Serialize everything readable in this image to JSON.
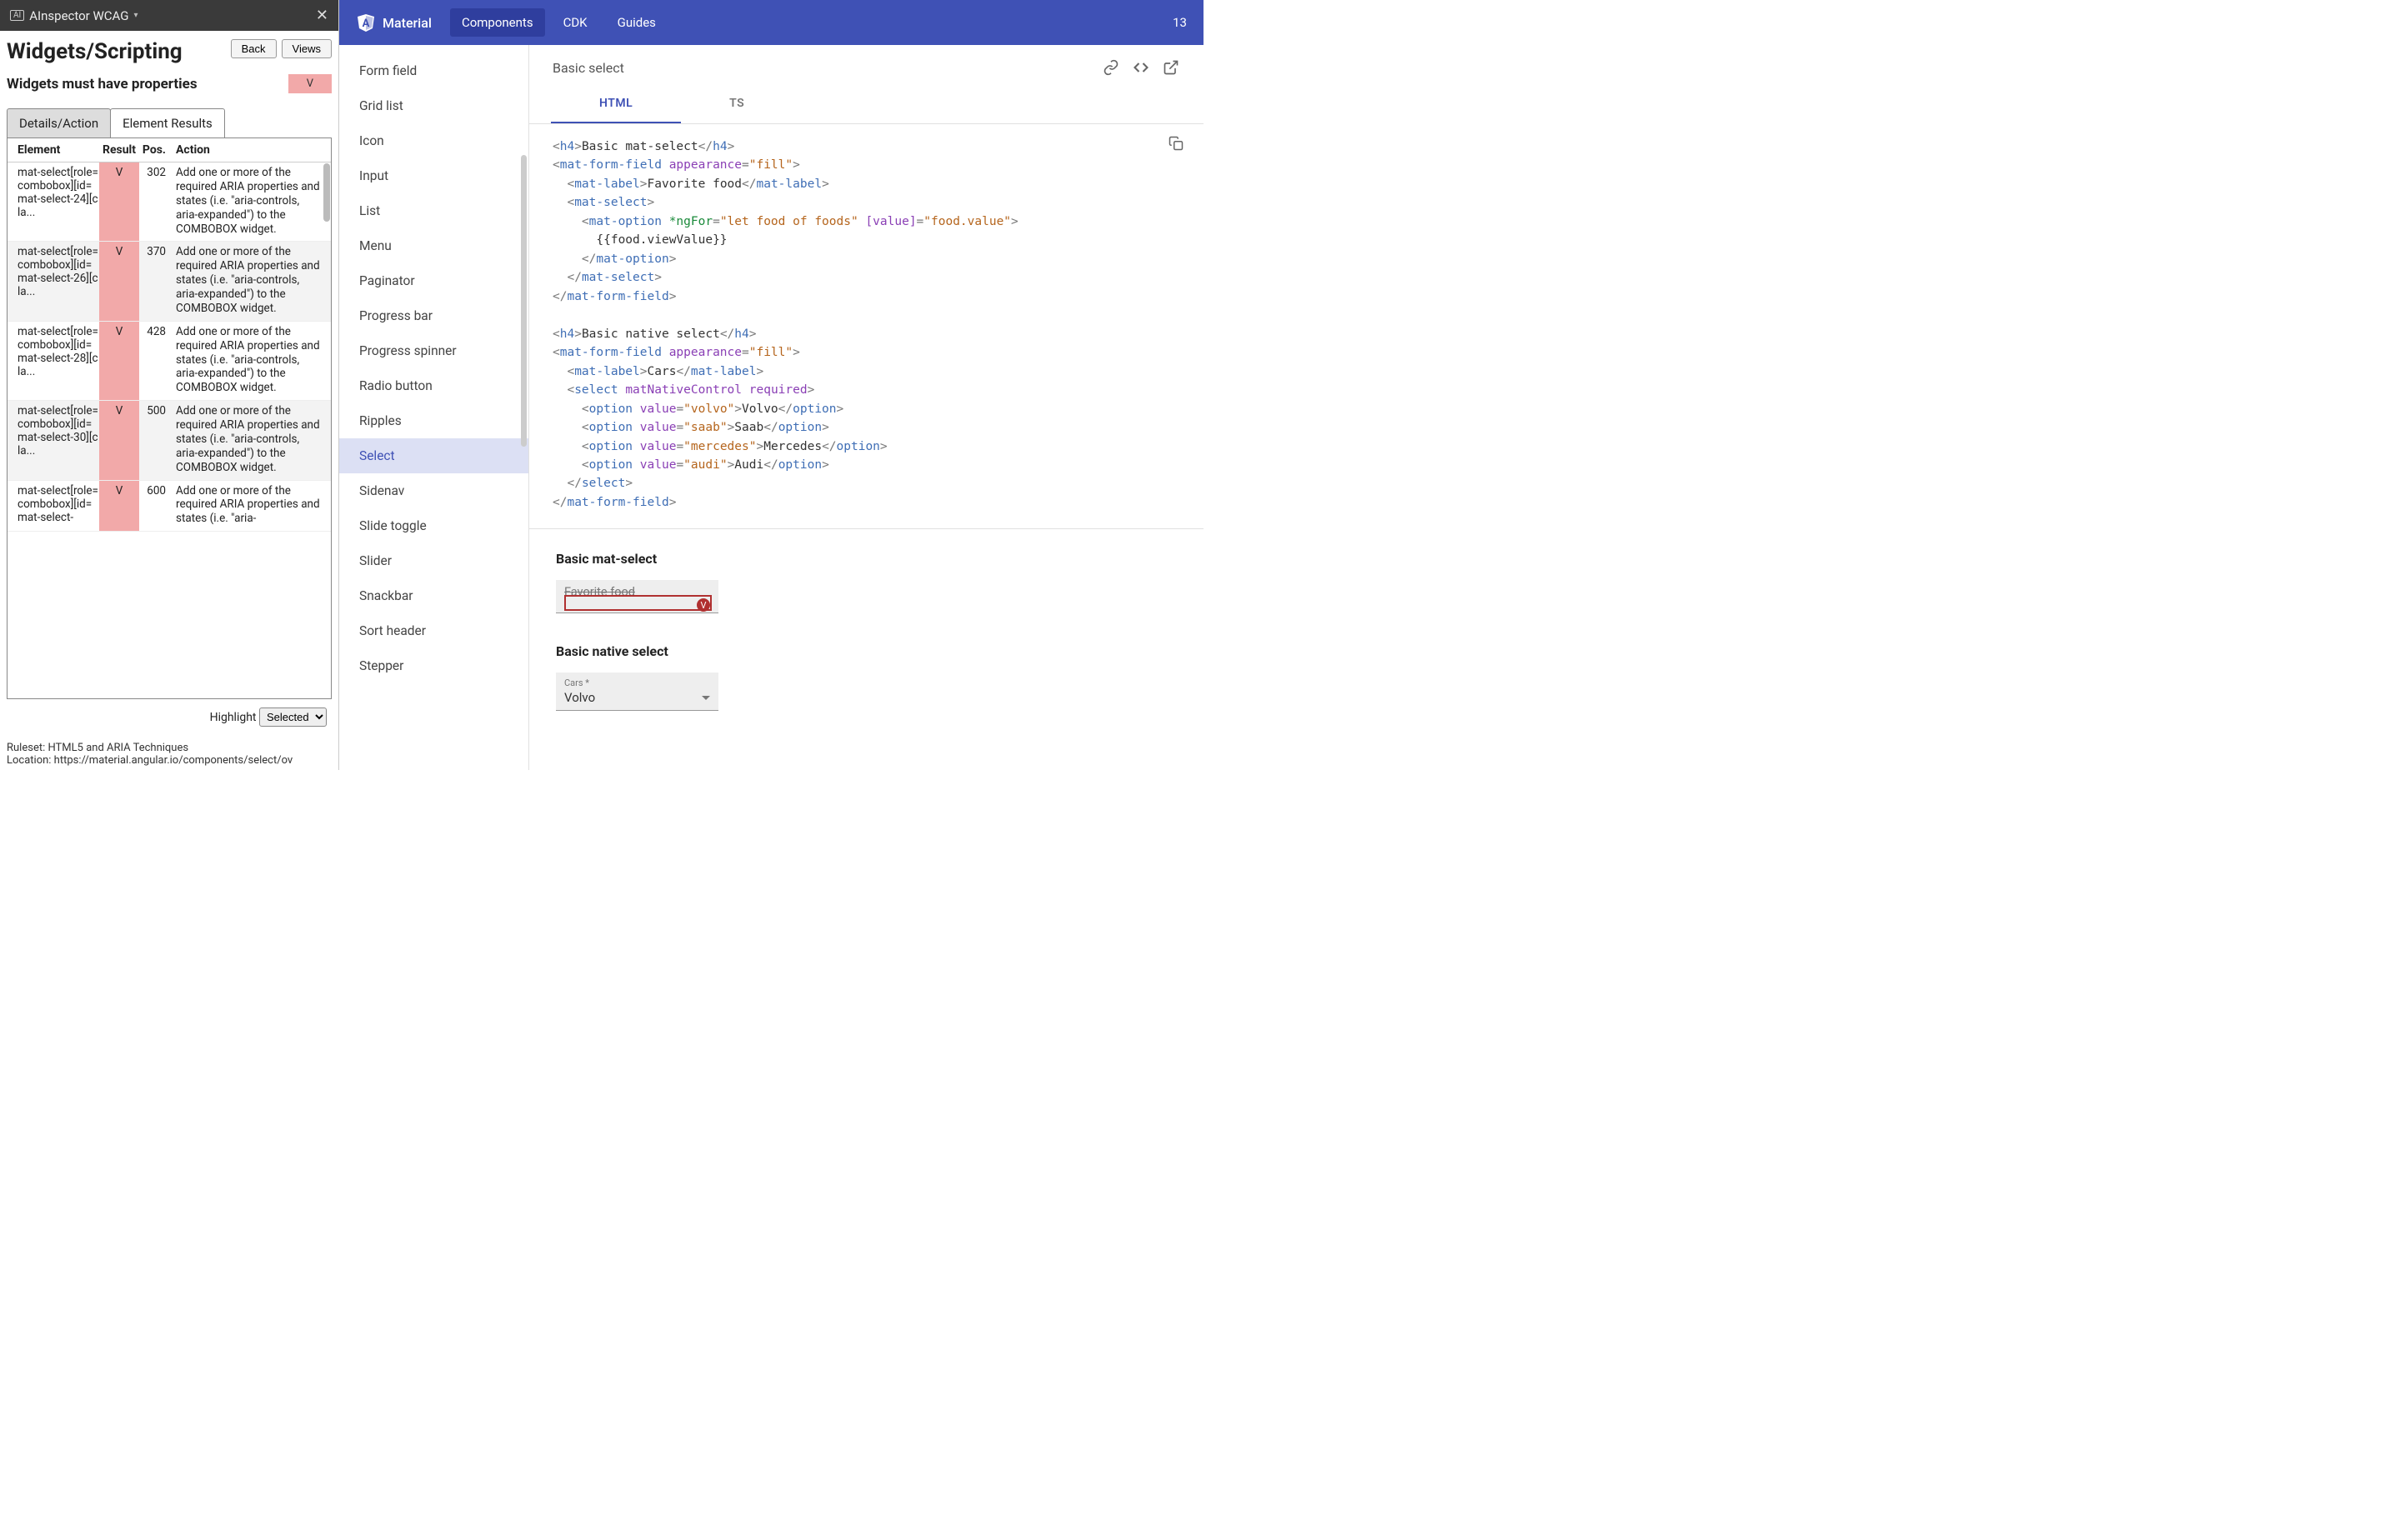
{
  "inspector": {
    "header_title": "AInspector WCAG",
    "page_title": "Widgets/Scripting",
    "back_btn": "Back",
    "views_btn": "Views",
    "rule_text": "Widgets must have properties",
    "violation_flag": "V",
    "tabs": {
      "details": "Details/Action",
      "results": "Element Results"
    },
    "columns": {
      "element": "Element",
      "result": "Result",
      "pos": "Pos.",
      "action": "Action"
    },
    "rows": [
      {
        "el": "mat-select[role=combobox][id=mat-select-24][cla...",
        "res": "V",
        "pos": "302",
        "act": "Add one or more of the required ARIA properties and states (i.e. \"aria-controls, aria-expanded\") to the COMBOBOX widget."
      },
      {
        "el": "mat-select[role=combobox][id=mat-select-26][cla...",
        "res": "V",
        "pos": "370",
        "act": "Add one or more of the required ARIA properties and states (i.e. \"aria-controls, aria-expanded\") to the COMBOBOX widget."
      },
      {
        "el": "mat-select[role=combobox][id=mat-select-28][cla...",
        "res": "V",
        "pos": "428",
        "act": "Add one or more of the required ARIA properties and states (i.e. \"aria-controls, aria-expanded\") to the COMBOBOX widget."
      },
      {
        "el": "mat-select[role=combobox][id=mat-select-30][cla...",
        "res": "V",
        "pos": "500",
        "act": "Add one or more of the required ARIA properties and states (i.e. \"aria-controls, aria-expanded\") to the COMBOBOX widget."
      },
      {
        "el": "mat-select[role=combobox][id=mat-select-",
        "res": "V",
        "pos": "600",
        "act": "Add one or more of the required ARIA properties and states (i.e. \"aria-"
      }
    ],
    "highlight_label": "Highlight",
    "highlight_value": "Selected",
    "footer_ruleset": "Ruleset: HTML5 and ARIA Techniques",
    "footer_location": "Location: https://material.angular.io/components/select/ov"
  },
  "material": {
    "brand": "Material",
    "nav": {
      "components": "Components",
      "cdk": "CDK",
      "guides": "Guides"
    },
    "version_fragment": "13",
    "sidenav": [
      "Form field",
      "Grid list",
      "Icon",
      "Input",
      "List",
      "Menu",
      "Paginator",
      "Progress bar",
      "Progress spinner",
      "Radio button",
      "Ripples",
      "Select",
      "Sidenav",
      "Slide toggle",
      "Slider",
      "Snackbar",
      "Sort header",
      "Stepper"
    ],
    "sidenav_selected": "Select",
    "example_title": "Basic select",
    "code_tabs": {
      "html": "HTML",
      "ts": "TS"
    },
    "demo": {
      "h1": "Basic mat-select",
      "ff1_label": "Favorite food",
      "ff1_badge": "V",
      "h2": "Basic native select",
      "ff2_label": "Cars *",
      "ff2_value": "Volvo"
    }
  }
}
